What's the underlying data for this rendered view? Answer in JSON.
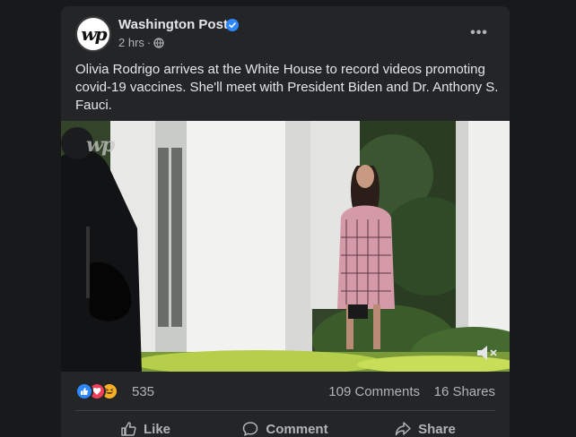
{
  "post": {
    "page_name": "Washington Post",
    "avatar_text": "wp",
    "time": "2 hrs",
    "separator": "·",
    "more_label": "•••",
    "text": "Olivia Rodrigo arrives at the White House to record videos promoting covid-19 vaccines. She'll meet with President Biden and Dr. Anthony S. Fauci.",
    "video": {
      "watermark": "wp",
      "muted": true
    }
  },
  "stats": {
    "reaction_icons": [
      "like-icon",
      "love-icon",
      "haha-icon"
    ],
    "reaction_count": "535",
    "comments": "109 Comments",
    "shares": "16 Shares"
  },
  "actions": {
    "like": "Like",
    "comment": "Comment",
    "share": "Share"
  },
  "colors": {
    "page_bg": "#18191a",
    "card_bg": "#242526",
    "text_primary": "#e4e6eb",
    "text_secondary": "#b0b3b8",
    "verified_blue": "#2d88ff",
    "love_red": "#f33e58",
    "haha_yellow": "#f7b125"
  }
}
